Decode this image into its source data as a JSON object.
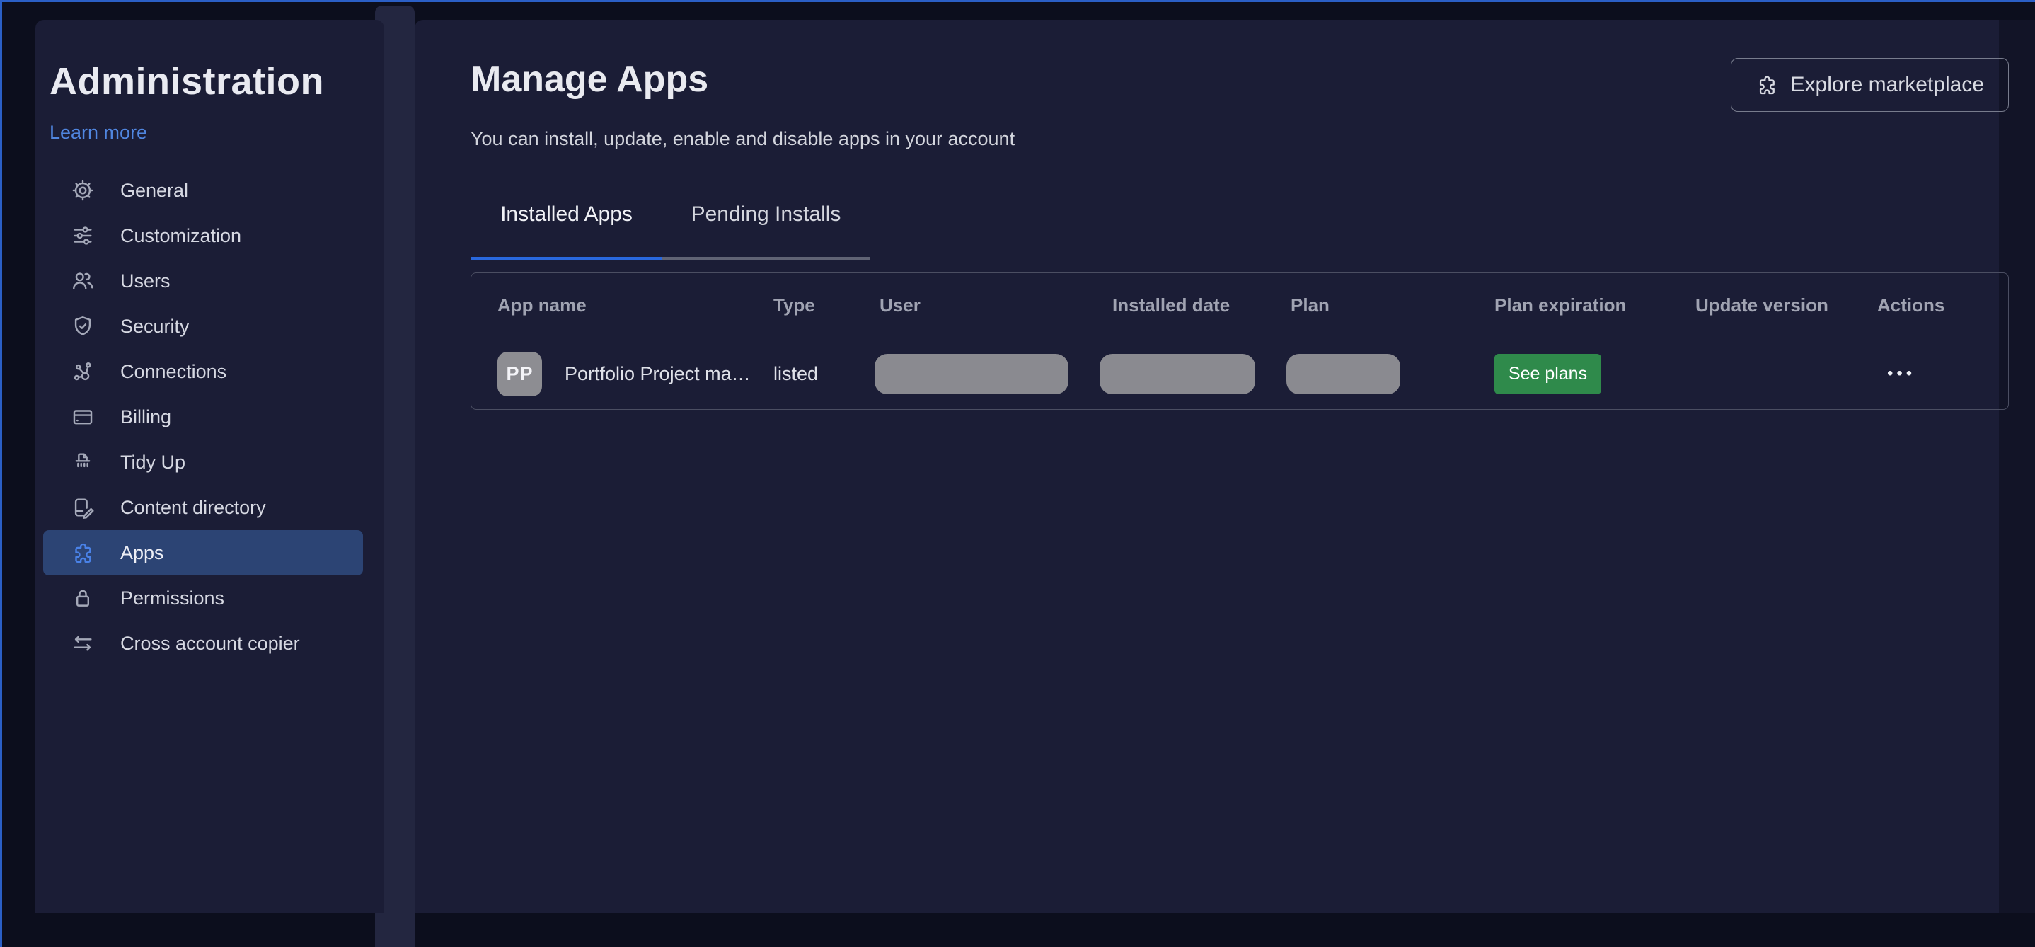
{
  "sidebar": {
    "title": "Administration",
    "learn_more": "Learn more",
    "items": [
      {
        "label": "General",
        "icon": "gear"
      },
      {
        "label": "Customization",
        "icon": "sliders"
      },
      {
        "label": "Users",
        "icon": "users"
      },
      {
        "label": "Security",
        "icon": "shield-check"
      },
      {
        "label": "Connections",
        "icon": "network"
      },
      {
        "label": "Billing",
        "icon": "credit-card"
      },
      {
        "label": "Tidy Up",
        "icon": "shredder"
      },
      {
        "label": "Content directory",
        "icon": "notebook-edit"
      },
      {
        "label": "Apps",
        "icon": "puzzle",
        "active": true
      },
      {
        "label": "Permissions",
        "icon": "lock"
      },
      {
        "label": "Cross account copier",
        "icon": "swap-arrows"
      }
    ]
  },
  "main": {
    "title": "Manage Apps",
    "subtitle": "You can install, update, enable and disable apps in your account",
    "explore_button": "Explore marketplace",
    "tabs": [
      {
        "label": "Installed Apps",
        "active": true
      },
      {
        "label": "Pending Installs",
        "active": false
      }
    ],
    "table": {
      "columns": [
        "App name",
        "Type",
        "User",
        "Installed date",
        "Plan",
        "Plan expiration",
        "Update version",
        "Actions"
      ],
      "rows": [
        {
          "avatar": "PP",
          "name": "Portfolio Project ma…",
          "type": "listed",
          "user": "(redacted)",
          "installed_date": "(redacted)",
          "plan": "(redacted)",
          "plan_expiration_button": "See plans",
          "update_version": "",
          "actions": "•••"
        }
      ]
    }
  },
  "colors": {
    "accent_blue": "#2968de",
    "highlight_blue": "#2c4474",
    "green_button": "#2f8a4b",
    "panel": "#1b1d36",
    "page_bg": "#0c0e1d",
    "outline": "#2b5fc6"
  }
}
